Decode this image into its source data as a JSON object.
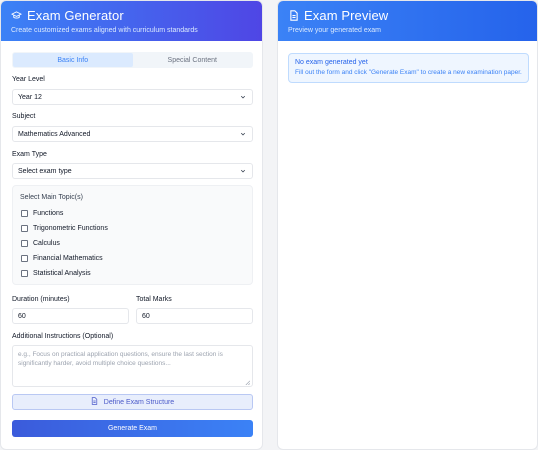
{
  "generator": {
    "title": "Exam Generator",
    "subtitle": "Create customized exams aligned with curriculum standards",
    "icon": "graduation-cap-icon",
    "tabs": [
      {
        "label": "Basic Info",
        "active": true
      },
      {
        "label": "Special Content",
        "active": false
      }
    ],
    "year_level": {
      "label": "Year Level",
      "value": "Year 12"
    },
    "subject": {
      "label": "Subject",
      "value": "Mathematics Advanced"
    },
    "exam_type": {
      "label": "Exam Type",
      "value": "Select exam type"
    },
    "topics": {
      "title": "Select Main Topic(s)",
      "items": [
        {
          "label": "Functions",
          "checked": false
        },
        {
          "label": "Trigonometric Functions",
          "checked": false
        },
        {
          "label": "Calculus",
          "checked": false
        },
        {
          "label": "Financial Mathematics",
          "checked": false
        },
        {
          "label": "Statistical Analysis",
          "checked": false
        }
      ]
    },
    "duration": {
      "label": "Duration (minutes)",
      "value": "60"
    },
    "total_marks": {
      "label": "Total Marks",
      "value": "60"
    },
    "instructions": {
      "label": "Additional Instructions (Optional)",
      "placeholder": "e.g., Focus on practical application questions, ensure the last section is significantly harder, avoid multiple choice questions..."
    },
    "define_button": "Define Exam Structure",
    "generate_button": "Generate Exam"
  },
  "preview": {
    "title": "Exam Preview",
    "subtitle": "Preview your generated exam",
    "icon": "document-icon",
    "empty_title": "No exam generated yet",
    "empty_text": "Fill out the form and click \"Generate Exam\" to create a new examination paper."
  },
  "colors": {
    "accent": "#3b82f6",
    "accent_dark": "#4f46e5"
  }
}
